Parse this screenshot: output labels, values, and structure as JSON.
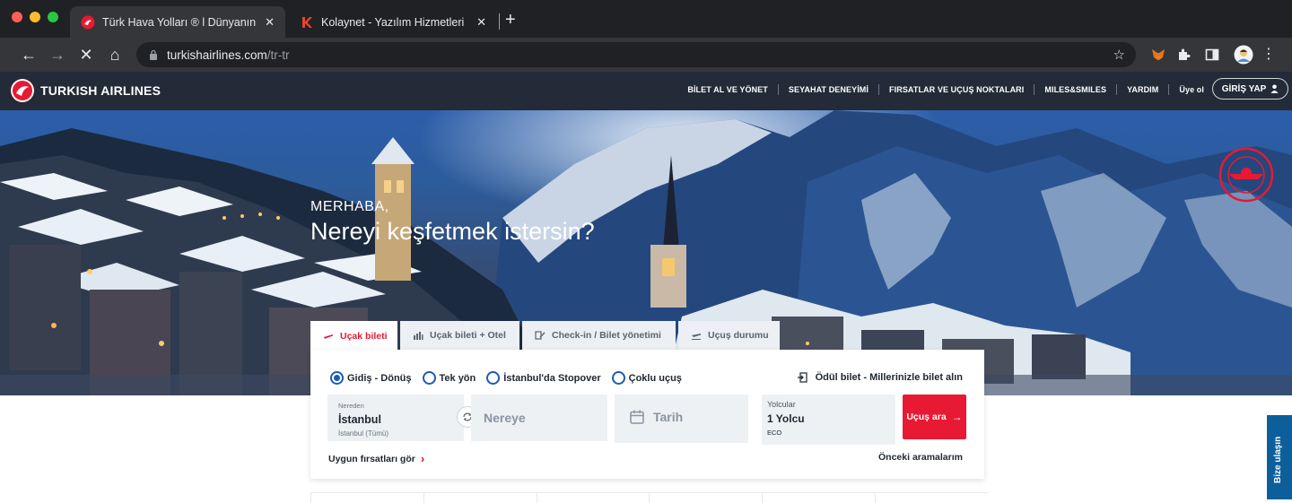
{
  "browser": {
    "tabs": [
      {
        "title": "Türk Hava Yolları ® l Dünyanın E",
        "active": true,
        "favicon": "turkish-airlines-favicon"
      },
      {
        "title": "Kolaynet - Yazılım Hizmetleri",
        "active": false,
        "favicon": "kolaynet-favicon"
      }
    ],
    "close_glyph": "✕",
    "new_tab_glyph": "+",
    "url_domain": "turkishairlines.com",
    "url_path": "/tr-tr",
    "nav": {
      "back": "←",
      "forward": "→",
      "stop": "✕",
      "home": "⌂"
    },
    "star_glyph": "☆",
    "menu_glyph": "⋮"
  },
  "header": {
    "brand": "TURKISH AIRLINES",
    "nav_items": [
      "BİLET AL VE YÖNET",
      "SEYAHAT DENEYİMİ",
      "FIRSATLAR VE UÇUŞ NOKTALARI",
      "MILES&SMILES",
      "YARDIM",
      "Üye ol"
    ],
    "login_label": "GİRİŞ YAP"
  },
  "hero": {
    "greeting": "MERHABA,",
    "headline": "Nereyi keşfetmek istersin?"
  },
  "booking": {
    "tabs": [
      {
        "label": "Uçak bileti",
        "active": true,
        "icon": "plane-icon"
      },
      {
        "label": "Uçak bileti + Otel",
        "active": false,
        "icon": "hotel-icon"
      },
      {
        "label": "Check-in / Bilet yönetimi",
        "active": false,
        "icon": "checkin-icon"
      },
      {
        "label": "Uçuş durumu",
        "active": false,
        "icon": "flight-status-icon"
      }
    ],
    "trip_types": [
      {
        "label": "Gidiş - Dönüş",
        "selected": true
      },
      {
        "label": "Tek yön",
        "selected": false
      },
      {
        "label": "İstanbul'da Stopover",
        "selected": false
      },
      {
        "label": "Çoklu uçuş",
        "selected": false
      }
    ],
    "award_link": "Ödül bilet - Millerinizle bilet alın",
    "from": {
      "label": "Nereden",
      "value": "İstanbul",
      "sub": "İstanbul (Tümü)"
    },
    "to": {
      "placeholder": "Nereye"
    },
    "date": {
      "placeholder": "Tarih"
    },
    "passengers": {
      "label": "Yolcular",
      "value": "1 Yolcu",
      "cabin": "ECO"
    },
    "search_label": "Uçuş ara",
    "search_arrow": "→",
    "deals_link": "Uygun fırsatları gör",
    "deals_chevron": "›",
    "recent_searches": "Önceki aramalarım"
  },
  "contact_tab": "Bize ulaşın",
  "colors": {
    "brand_red": "#e81932",
    "header_navy": "#232b38",
    "radio_blue": "#1a5bb7",
    "contact_blue": "#0d5f9b"
  }
}
